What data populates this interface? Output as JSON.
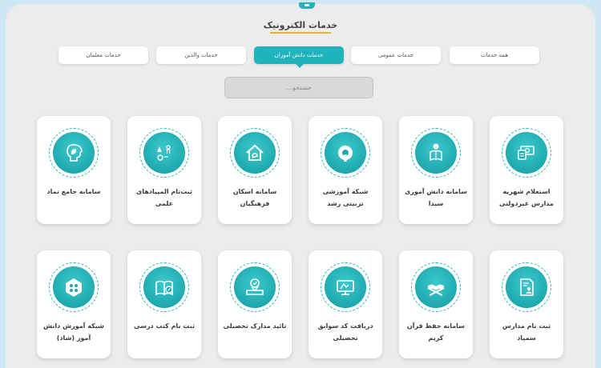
{
  "header": {
    "title": "خدمات الکترونیک"
  },
  "tabs": [
    {
      "label": "همه خدمات",
      "active": false
    },
    {
      "label": "خدمات عمومی",
      "active": false
    },
    {
      "label": "خدمات دانش آموزان",
      "active": true
    },
    {
      "label": "خدمات والدین",
      "active": false
    },
    {
      "label": "خدمات معلمان",
      "active": false
    }
  ],
  "search": {
    "placeholder": "جستجو..."
  },
  "cards": [
    {
      "label": "استعلام شهریه مدارس غیردولتی",
      "icon": "money-icon"
    },
    {
      "label": "سامانه دانش آموزی سیدا",
      "icon": "student-reading-icon"
    },
    {
      "label": "شبکه آموزشی تربیتی رشد",
      "icon": "roshd-logo-icon"
    },
    {
      "label": "سامانه اسکان فرهنگیان",
      "icon": "house-icon"
    },
    {
      "label": "ثبت‌نام المپیادهای علمی",
      "icon": "science-icon"
    },
    {
      "label": "سامانه جامع نماد",
      "icon": "head-leaf-icon"
    },
    {
      "label": "ثبت نام مدارس سمپاد",
      "icon": "document-user-icon"
    },
    {
      "label": "سامانه حفظ قرآن کریم",
      "icon": "quran-icon"
    },
    {
      "label": "دریافت کد سوابق تحصیلی",
      "icon": "monitor-icon"
    },
    {
      "label": "تائید مدارک تحصیلی",
      "icon": "certificate-icon"
    },
    {
      "label": "ثبت نام کتب درسی",
      "icon": "book-icon"
    },
    {
      "label": "شبکه آموزش دانش آموز (شاد)",
      "icon": "shad-logo-icon"
    }
  ],
  "colors": {
    "accent": "#1fb4bc",
    "title_underline": "#e2b23c",
    "background": "#cfe8f6"
  }
}
